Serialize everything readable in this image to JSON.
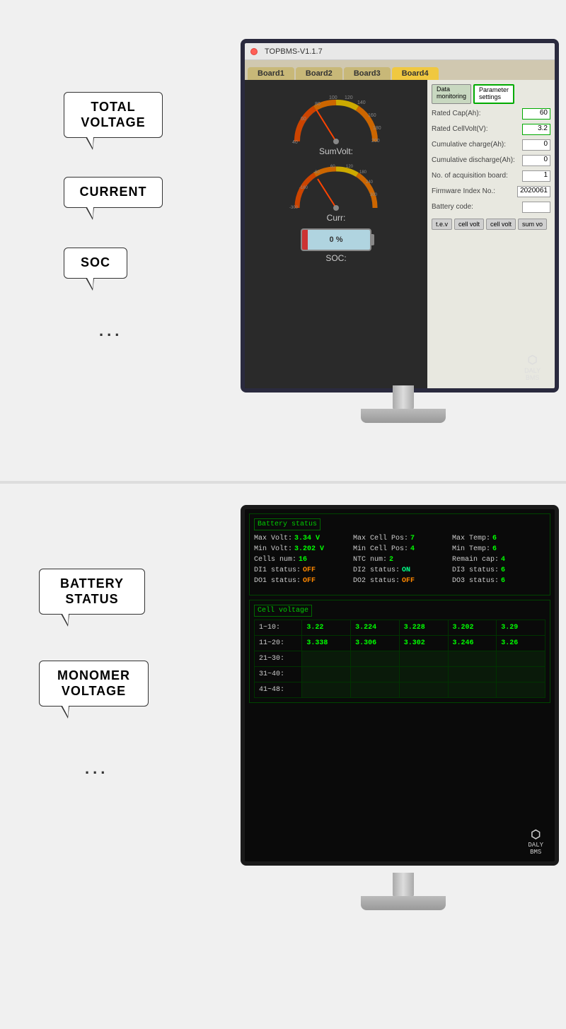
{
  "top_section": {
    "bubbles": {
      "total_voltage": "TOTAL\nVOLTAGE",
      "total_voltage_line1": "TOTAL",
      "total_voltage_line2": "VOLTAGE",
      "current": "CURRENT",
      "soc": "SOC",
      "dots": "..."
    },
    "bms_app": {
      "title": "TOPBMS-V1.1.7",
      "tabs": [
        "Board1",
        "Board2",
        "Board3",
        "Board4"
      ],
      "active_tab": "Board4",
      "panel_tabs": [
        "Data\nmonitoring",
        "Parameter\nsettings"
      ],
      "active_panel_tab": "Parameter\nsettings",
      "gauges": {
        "sum_volt_label": "SumVolt:",
        "curr_label": "Curr:",
        "soc_label": "SOC:"
      },
      "right_panel": {
        "rated_cap_label": "Rated Cap(Ah):",
        "rated_cap_value": "60",
        "rated_cell_volt_label": "Rated CellVolt(V):",
        "rated_cell_volt_value": "3.2",
        "cumulative_charge_label": "Cumulative charge(Ah):",
        "cumulative_charge_value": "0",
        "cumulative_discharge_label": "Cumulative discharge(Ah):",
        "cumulative_discharge_value": "0",
        "acq_board_label": "No. of acquisition board:",
        "acq_board_value": "1",
        "firmware_label": "Firmware Index No.:",
        "firmware_value": "2020061",
        "battery_code_label": "Battery code:",
        "battery_code_value": "",
        "buttons": [
          "t.e.v",
          "cell volt",
          "cell volt",
          "sum vo"
        ]
      },
      "battery": {
        "soc_percent": "0 %"
      }
    }
  },
  "bottom_section": {
    "bubbles": {
      "battery_status_line1": "BATTERY",
      "battery_status_line2": "STATUS",
      "monomer_voltage_line1": "MONOMER",
      "monomer_voltage_line2": "VOLTAGE",
      "dots": "..."
    },
    "bms_app2": {
      "battery_status_section": "Battery status",
      "fields": {
        "max_volt_label": "Max Volt:",
        "max_volt_value": "3.34 V",
        "max_cell_pos_label": "Max Cell Pos:",
        "max_cell_pos_value": "7",
        "max_temp_label": "Max Temp:",
        "max_temp_value": "6",
        "min_volt_label": "Min Volt:",
        "min_volt_value": "3.202 V",
        "min_cell_pos_label": "Min Cell Pos:",
        "min_cell_pos_value": "4",
        "min_temp_label": "Min Temp:",
        "min_temp_value": "6",
        "cells_num_label": "Cells num:",
        "cells_num_value": "16",
        "ntc_num_label": "NTC num:",
        "ntc_num_value": "2",
        "remain_cap_label": "Remain cap:",
        "remain_cap_value": "4",
        "di1_label": "DI1 status:",
        "di1_value": "OFF",
        "di2_label": "DI2 status:",
        "di2_value": "ON",
        "di3_label": "DI3 status:",
        "di3_value": "6",
        "do1_label": "DO1 status:",
        "do1_value": "OFF",
        "do2_label": "DO2 status:",
        "do2_value": "OFF",
        "do3_label": "DO3 status:",
        "do3_value": "6"
      },
      "cell_voltage_section": "Cell voltage",
      "cell_table": {
        "rows": [
          {
            "label": "1~10:",
            "values": [
              "3.22",
              "3.224",
              "3.228",
              "3.202",
              "3.29"
            ]
          },
          {
            "label": "11~20:",
            "values": [
              "3.338",
              "3.306",
              "3.302",
              "3.246",
              "3.26"
            ]
          },
          {
            "label": "21~30:",
            "values": [
              "",
              "",
              "",
              "",
              ""
            ]
          },
          {
            "label": "31~40:",
            "values": [
              "",
              "",
              "",
              "",
              ""
            ]
          },
          {
            "label": "41~48:",
            "values": [
              "",
              "",
              "",
              "",
              ""
            ]
          }
        ]
      }
    }
  }
}
